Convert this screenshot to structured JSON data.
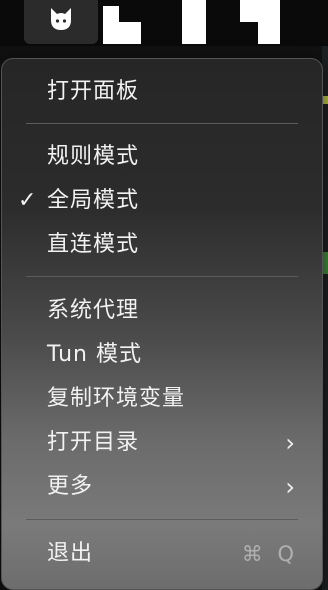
{
  "menubar": {
    "app_icon": "cat-icon"
  },
  "menu": {
    "open_panel": "打开面板",
    "rule_mode": "规则模式",
    "global_mode": "全局模式",
    "global_mode_checked": true,
    "check_mark": "✓",
    "direct_mode": "直连模式",
    "system_proxy": "系统代理",
    "tun_mode": "Tun 模式",
    "copy_env": "复制环境变量",
    "open_dir": "打开目录",
    "more": "更多",
    "quit": "退出",
    "quit_shortcut": "⌘ Q",
    "submenu_arrow": "›"
  },
  "colors": {
    "menu_text": "#f2f2f2",
    "shortcut_text": "#b0b0b0",
    "separator": "#5c5c5c"
  }
}
